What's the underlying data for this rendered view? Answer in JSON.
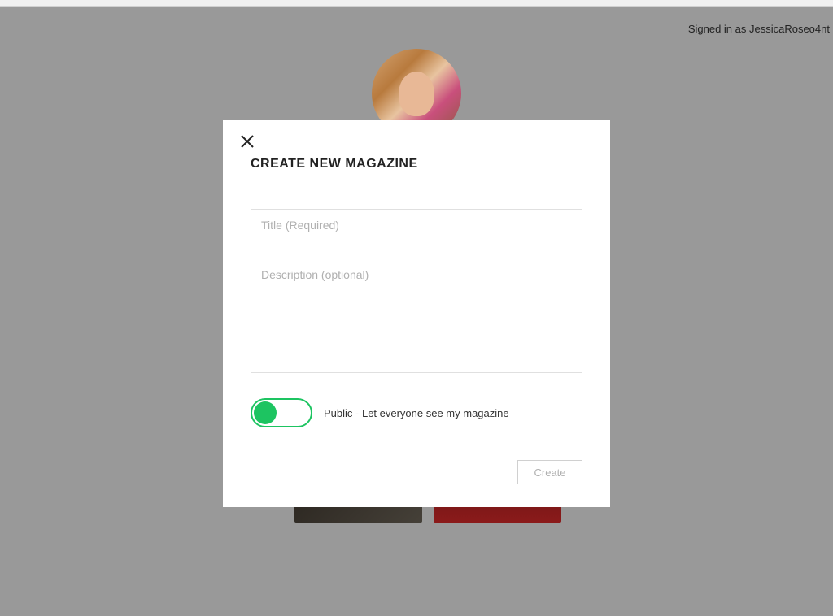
{
  "header": {
    "signed_in_text": "Signed in as JessicaRoseo4nt"
  },
  "modal": {
    "title": "CREATE NEW MAGAZINE",
    "title_input_placeholder": "Title (Required)",
    "title_input_value": "",
    "description_input_placeholder": "Description (optional)",
    "description_input_value": "",
    "toggle": {
      "label": "Public - Let everyone see my magazine",
      "state": true
    },
    "create_button_label": "Create"
  }
}
